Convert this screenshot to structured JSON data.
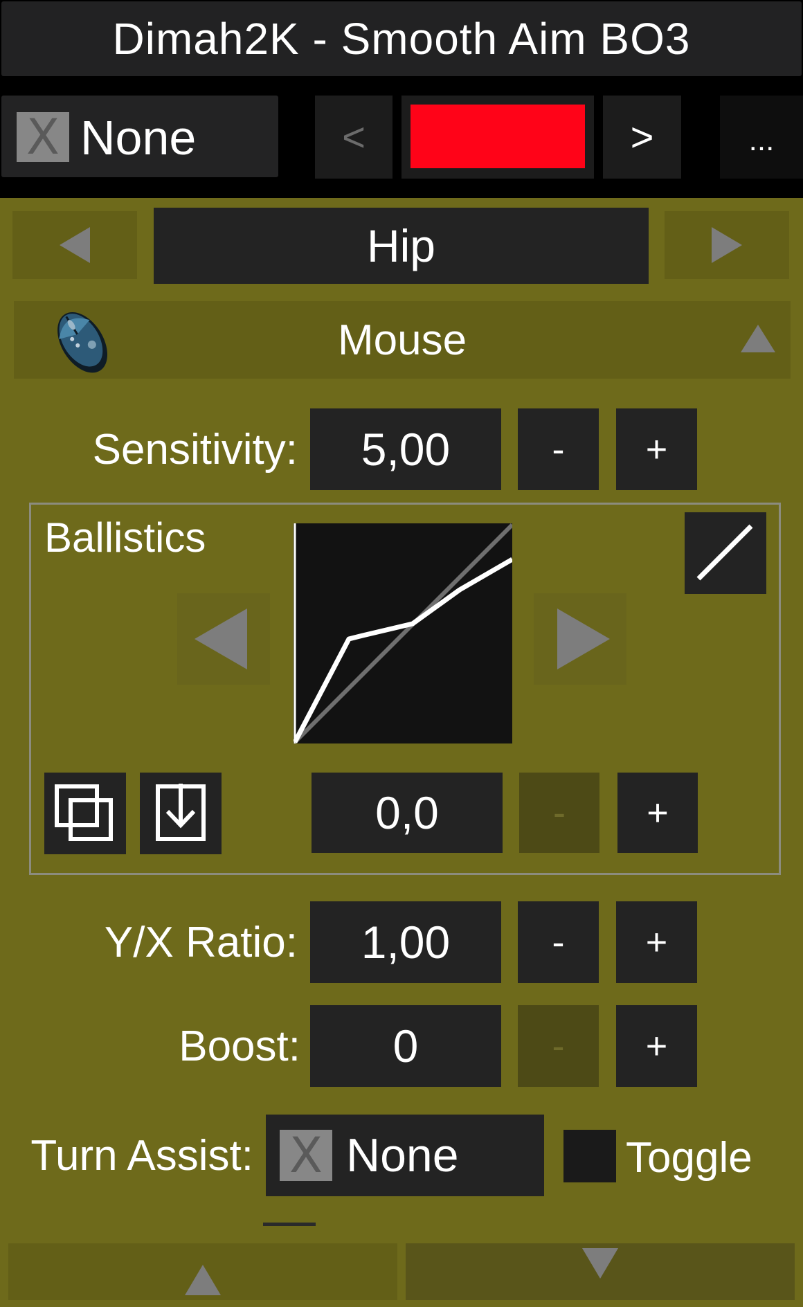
{
  "header": {
    "title": "Dimah2K - Smooth Aim BO3",
    "modifier_badge": "X",
    "modifier_label": "None",
    "prev_label": "<",
    "next_label": ">",
    "color_swatch": "#ff0318",
    "more_label": "..."
  },
  "mode": {
    "current": "Hip"
  },
  "device": {
    "label": "Mouse"
  },
  "sensitivity": {
    "label": "Sensitivity:",
    "value": "5,00",
    "minus": "-",
    "plus": "+"
  },
  "ballistics": {
    "title": "Ballistics",
    "value": "0,0",
    "minus": "-",
    "plus": "+"
  },
  "yx_ratio": {
    "label": "Y/X Ratio:",
    "value": "1,00",
    "minus": "-",
    "plus": "+"
  },
  "boost": {
    "label": "Boost:",
    "value": "0",
    "minus": "-",
    "plus": "+"
  },
  "turn_assist": {
    "label": "Turn Assist:",
    "badge": "X",
    "value": "None",
    "toggle_label": "Toggle"
  },
  "colors": {
    "background": "#6e6a1b",
    "accent_red": "#ff0318"
  }
}
